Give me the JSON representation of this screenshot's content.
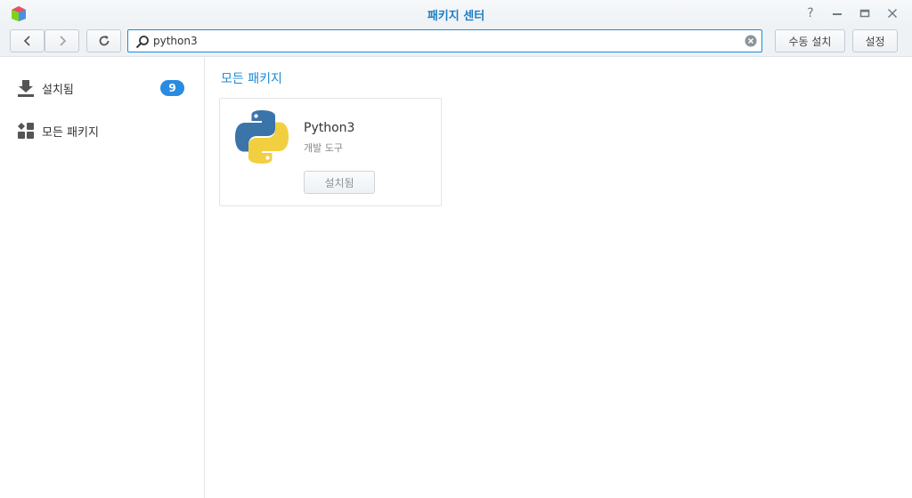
{
  "window": {
    "title": "패키지 센터"
  },
  "toolbar": {
    "search_value": "python3",
    "manual_install_label": "수동 설치",
    "settings_label": "설정"
  },
  "sidebar": {
    "items": [
      {
        "label": "설치됨",
        "badge": "9",
        "icon": "download-icon"
      },
      {
        "label": "모든 패키지",
        "icon": "grid-icon"
      }
    ]
  },
  "main": {
    "section_title": "모든 패키지",
    "packages": [
      {
        "name": "Python3",
        "category": "개발 도구",
        "button_label": "설치됨",
        "icon": "python-logo"
      }
    ]
  },
  "colors": {
    "accent": "#1b8ad6",
    "badge": "#2a8be0",
    "title": "#1b7fc4"
  }
}
